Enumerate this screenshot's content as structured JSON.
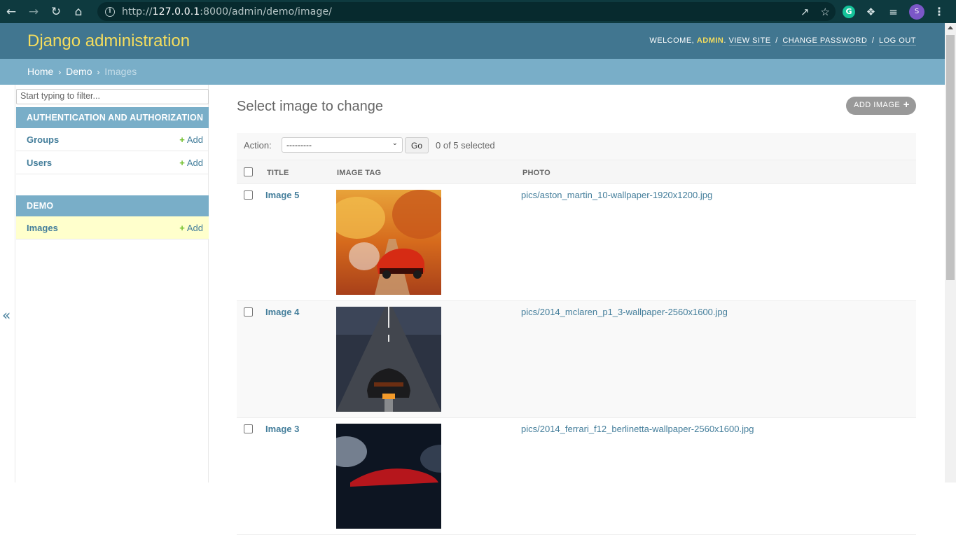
{
  "browser": {
    "url_prefix": "http://",
    "url_host": "127.0.0.1",
    "url_rest": ":8000/admin/demo/image/",
    "profile_initial": "S",
    "grammarly_letter": "G"
  },
  "header": {
    "brand": "Django administration",
    "welcome": "WELCOME,",
    "username": "ADMIN",
    "view_site": "VIEW SITE",
    "change_password": "CHANGE PASSWORD",
    "log_out": "LOG OUT",
    "separator": "/"
  },
  "breadcrumbs": {
    "home": "Home",
    "demo": "Demo",
    "current": "Images",
    "separator": "›"
  },
  "sidebar": {
    "filter_placeholder": "Start typing to filter...",
    "collapse": "«",
    "apps": [
      {
        "caption": "AUTHENTICATION AND AUTHORIZATION",
        "models": [
          {
            "name": "Groups",
            "add": "Add"
          },
          {
            "name": "Users",
            "add": "Add"
          }
        ]
      },
      {
        "caption": "DEMO",
        "models": [
          {
            "name": "Images",
            "add": "Add"
          }
        ]
      }
    ]
  },
  "content": {
    "title": "Select image to change",
    "add_button": "ADD IMAGE",
    "action_label": "Action:",
    "action_selected": "---------",
    "go": "Go",
    "selection_count": "0 of 5 selected",
    "columns": [
      "TITLE",
      "IMAGE TAG",
      "PHOTO"
    ],
    "rows": [
      {
        "title": "Image 5",
        "photo": "pics/aston_martin_10-wallpaper-1920x1200.jpg"
      },
      {
        "title": "Image 4",
        "photo": "pics/2014_mclaren_p1_3-wallpaper-2560x1600.jpg"
      },
      {
        "title": "Image 3",
        "photo": "pics/2014_ferrari_f12_berlinetta-wallpaper-2560x1600.jpg"
      }
    ]
  },
  "colors": {
    "header_bg": "#417690",
    "brand": "#f5dd5d",
    "breadcrumb_bg": "#79aec8",
    "link": "#447e9b",
    "add_plus": "#70bf2b"
  }
}
